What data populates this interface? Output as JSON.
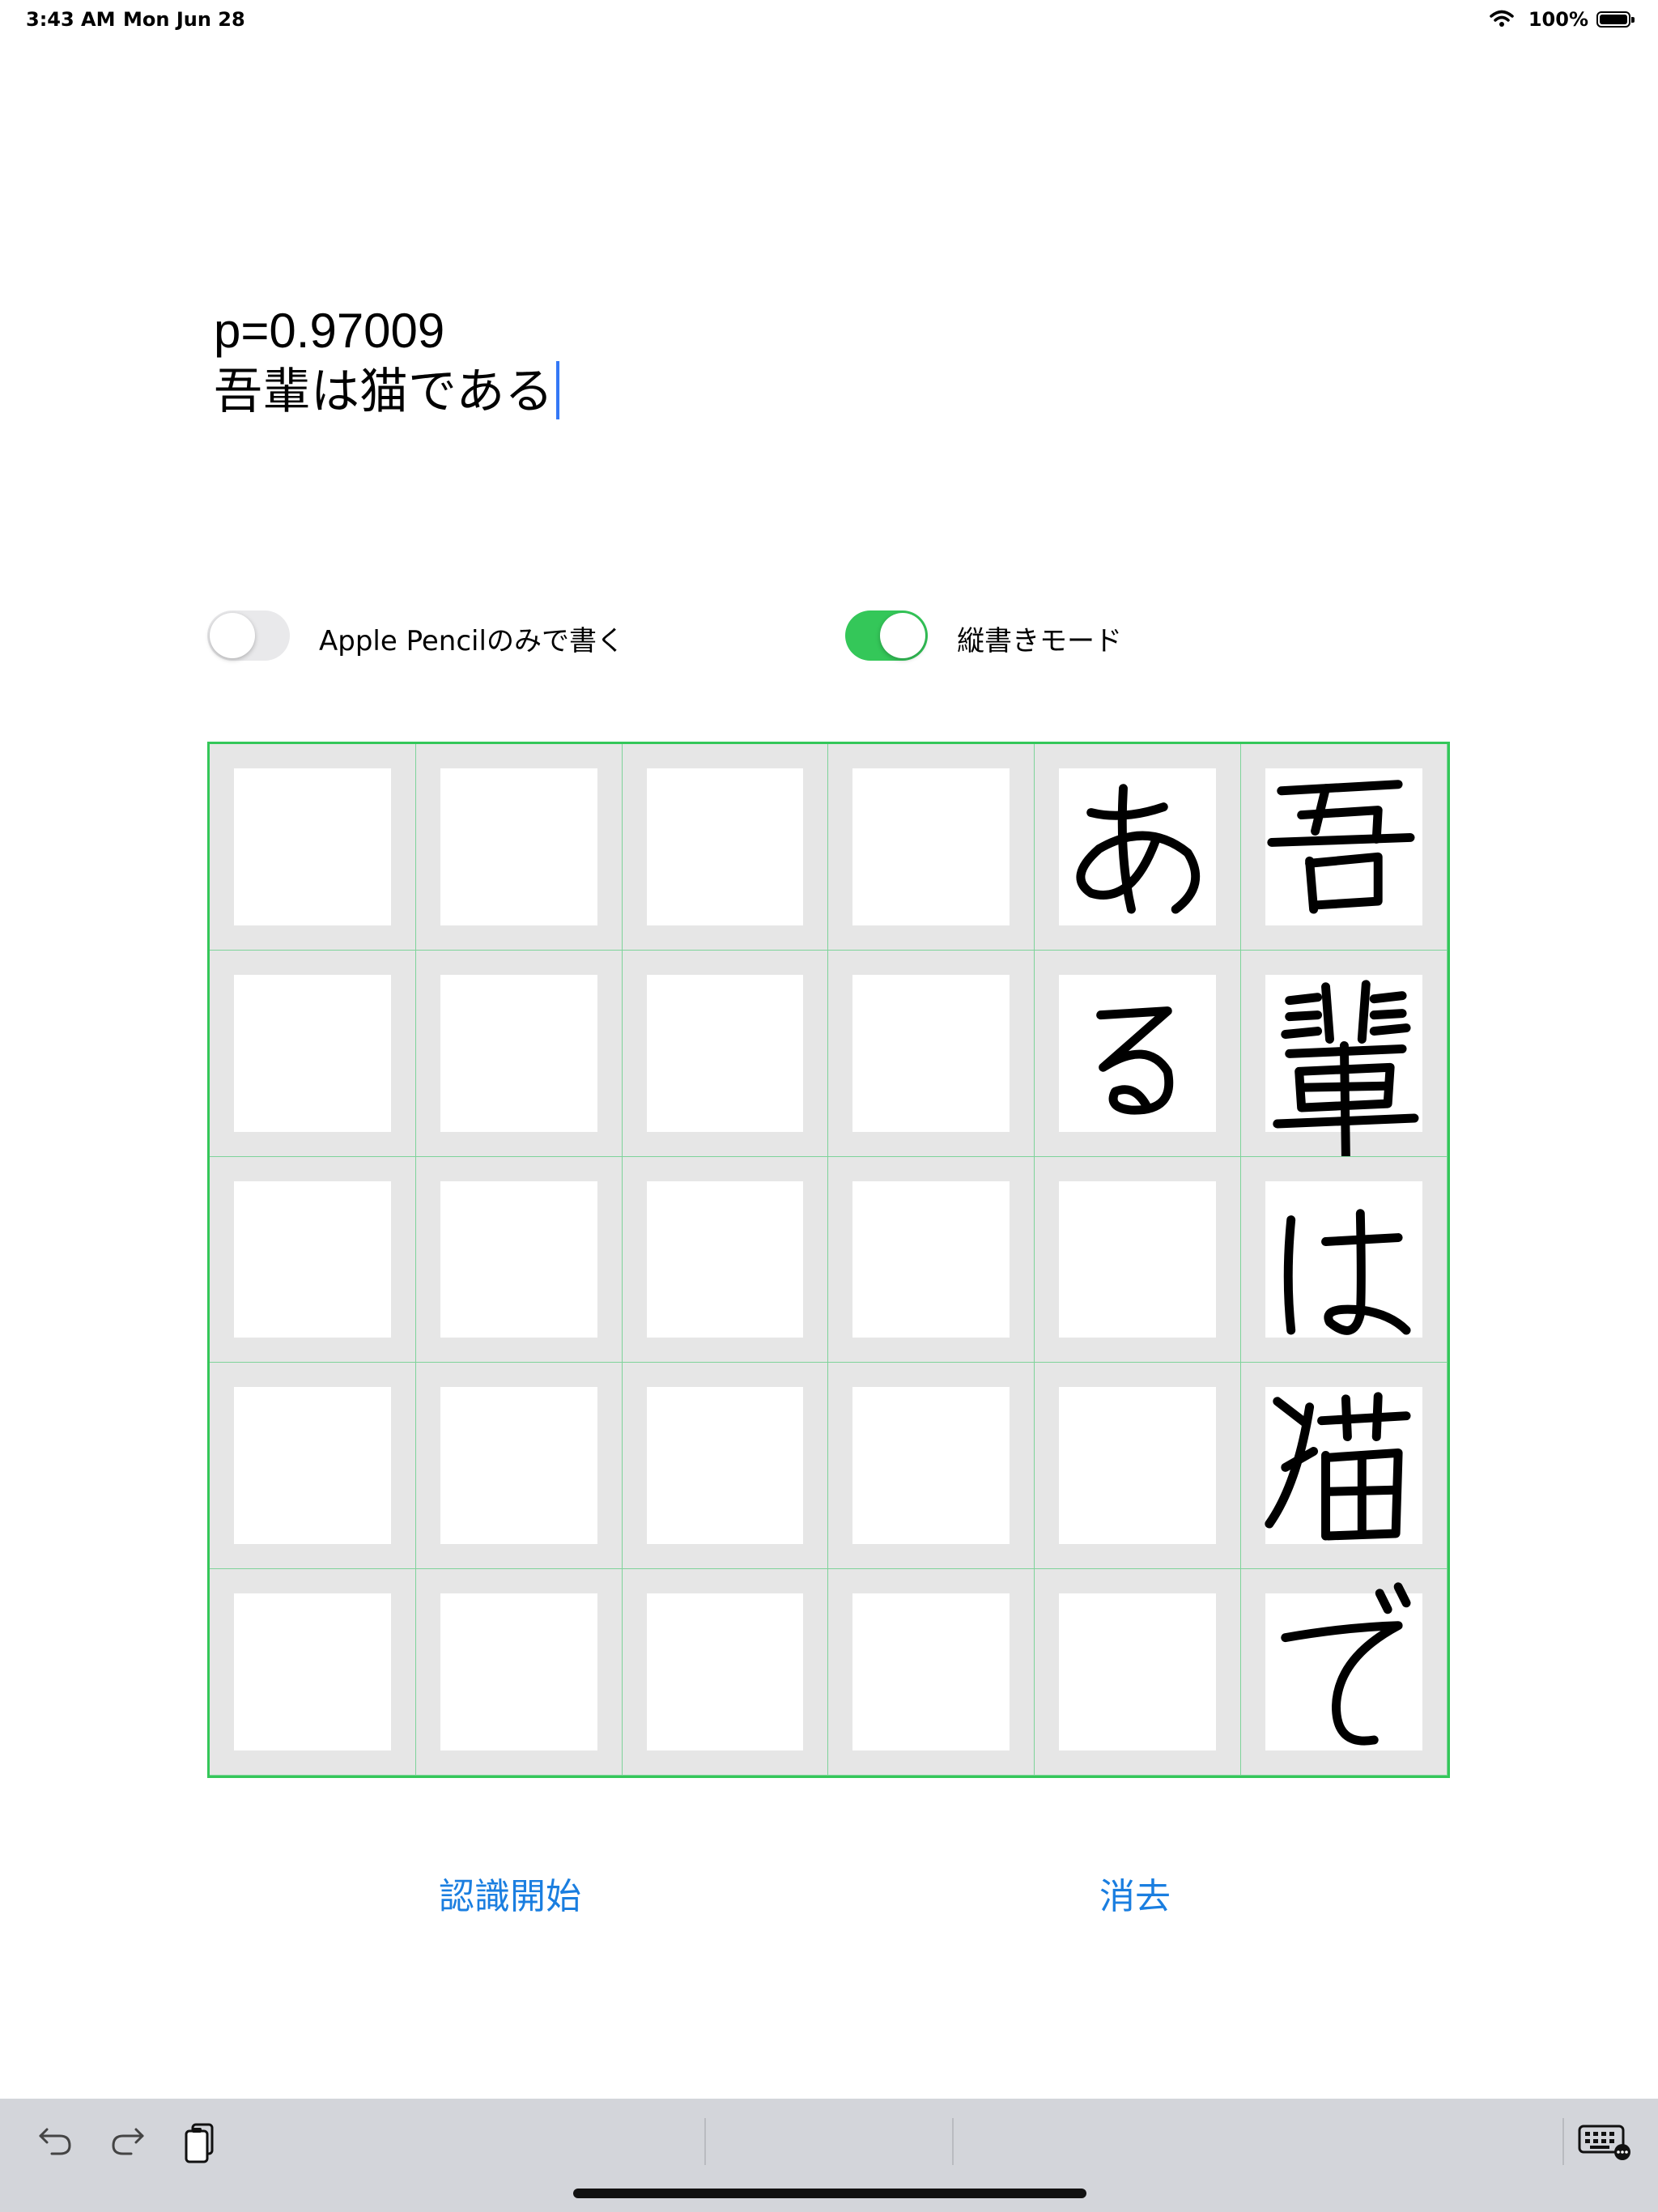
{
  "status_bar": {
    "time": "3:43 AM",
    "date": "Mon Jun 28",
    "battery_pct": "100%"
  },
  "result": {
    "probability": "p=0.97009",
    "text": "吾輩は猫である"
  },
  "toggles": {
    "pencil_only": {
      "label": "Apple Pencilのみで書く",
      "on": false
    },
    "vertical_mode": {
      "label": "縦書きモード",
      "on": true
    }
  },
  "grid": {
    "columns": 6,
    "rows": 5,
    "handwritten_cells": [
      {
        "col": 5,
        "row": 0,
        "char": "吾"
      },
      {
        "col": 5,
        "row": 1,
        "char": "輩"
      },
      {
        "col": 5,
        "row": 2,
        "char": "は"
      },
      {
        "col": 5,
        "row": 3,
        "char": "猫"
      },
      {
        "col": 5,
        "row": 4,
        "char": "で"
      },
      {
        "col": 4,
        "row": 0,
        "char": "あ"
      },
      {
        "col": 4,
        "row": 1,
        "char": "る"
      }
    ]
  },
  "buttons": {
    "recognize": "認識開始",
    "clear": "消去"
  },
  "keyboard_bar": {
    "icons": [
      "undo-icon",
      "redo-icon",
      "paste-icon",
      "keyboard-icon"
    ]
  }
}
